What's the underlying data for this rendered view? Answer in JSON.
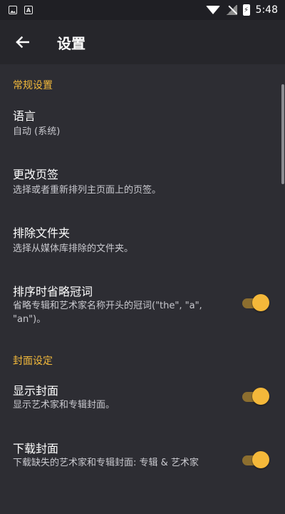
{
  "status_bar": {
    "time": "5:48"
  },
  "toolbar": {
    "title": "设置"
  },
  "sections": {
    "general": "常规设置",
    "cover": "封面设定"
  },
  "items": {
    "language": {
      "title": "语言",
      "subtitle": "自动 (系统)"
    },
    "tabs": {
      "title": "更改页签",
      "subtitle": "选择或者重新排列主页面上的页签。"
    },
    "exclude": {
      "title": "排除文件夹",
      "subtitle": "选择从媒体库排除的文件夹。"
    },
    "articles": {
      "title": "排序时省略冠词",
      "subtitle": "省略专辑和艺术家名称开头的冠词(\"the\", \"a\", \"an\")。",
      "enabled": true
    },
    "show_cover": {
      "title": "显示封面",
      "subtitle": "显示艺术家和专辑封面。",
      "enabled": true
    },
    "download_cover": {
      "title": "下载封面",
      "subtitle": "下载缺失的艺术家和专辑封面: 专辑 & 艺术家",
      "enabled": true
    }
  },
  "colors": {
    "accent": "#f2b93b",
    "background": "#2d2d33",
    "toolbar": "#26262b"
  }
}
